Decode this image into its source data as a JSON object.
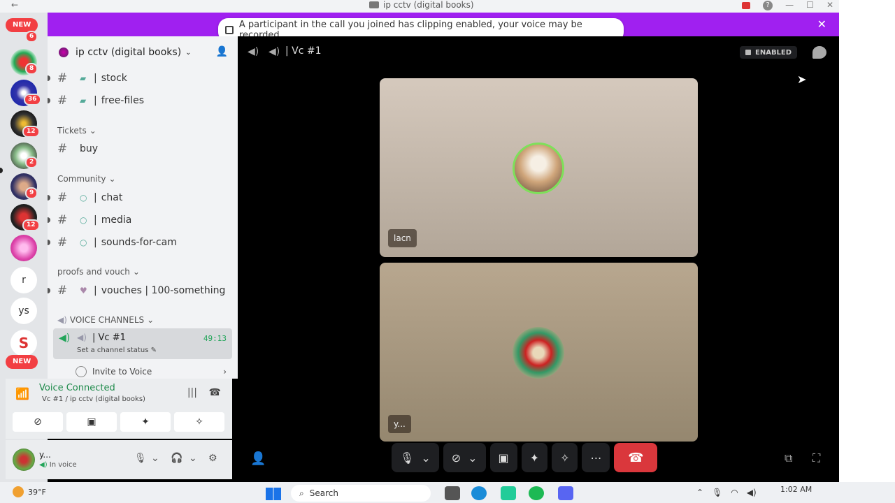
{
  "window": {
    "title": "ip cctv (digital books)",
    "back": "←",
    "forward": "→"
  },
  "notice": {
    "text": "A participant in the call you joined has clipping enabled, your voice may be recorded.",
    "close": "✕"
  },
  "rail": {
    "new_label": "NEW",
    "badges": [
      "6",
      "8",
      "36",
      "12",
      "2",
      "9",
      "12"
    ],
    "letters": [
      "r",
      "ys"
    ]
  },
  "guild": {
    "name": "ip cctv (digital books)"
  },
  "channels": {
    "stock": "stock",
    "free_files": "free-files",
    "cat_tickets": "Tickets",
    "buy": "buy",
    "cat_community": "Community",
    "chat": "chat",
    "media": "media",
    "sounds": "sounds-for-cam",
    "cat_proofs": "proofs and vouch",
    "vouches": "vouches | 100-something",
    "cat_voice": "VOICE CHANNELS",
    "vc_name": "Vc #1",
    "vc_time": "49:13",
    "vc_status": "Set a channel status",
    "invite_voice": "Invite to Voice"
  },
  "voice_panel": {
    "title": "Voice Connected",
    "subtitle": "Vc #1 / ip cctv (digital books)"
  },
  "user": {
    "name": "y...",
    "status": "In voice"
  },
  "stage": {
    "channel": "Vc #1",
    "clipping": "ENABLED",
    "participants": [
      {
        "name": "lacn"
      },
      {
        "name": "y..."
      }
    ]
  },
  "taskbar": {
    "temp": "39°F",
    "search": "Search",
    "time": "1:02 AM"
  },
  "colors": {
    "accent_notice": "#a020f0",
    "voice_green": "#23a55a",
    "hangup_red": "#da373c"
  }
}
